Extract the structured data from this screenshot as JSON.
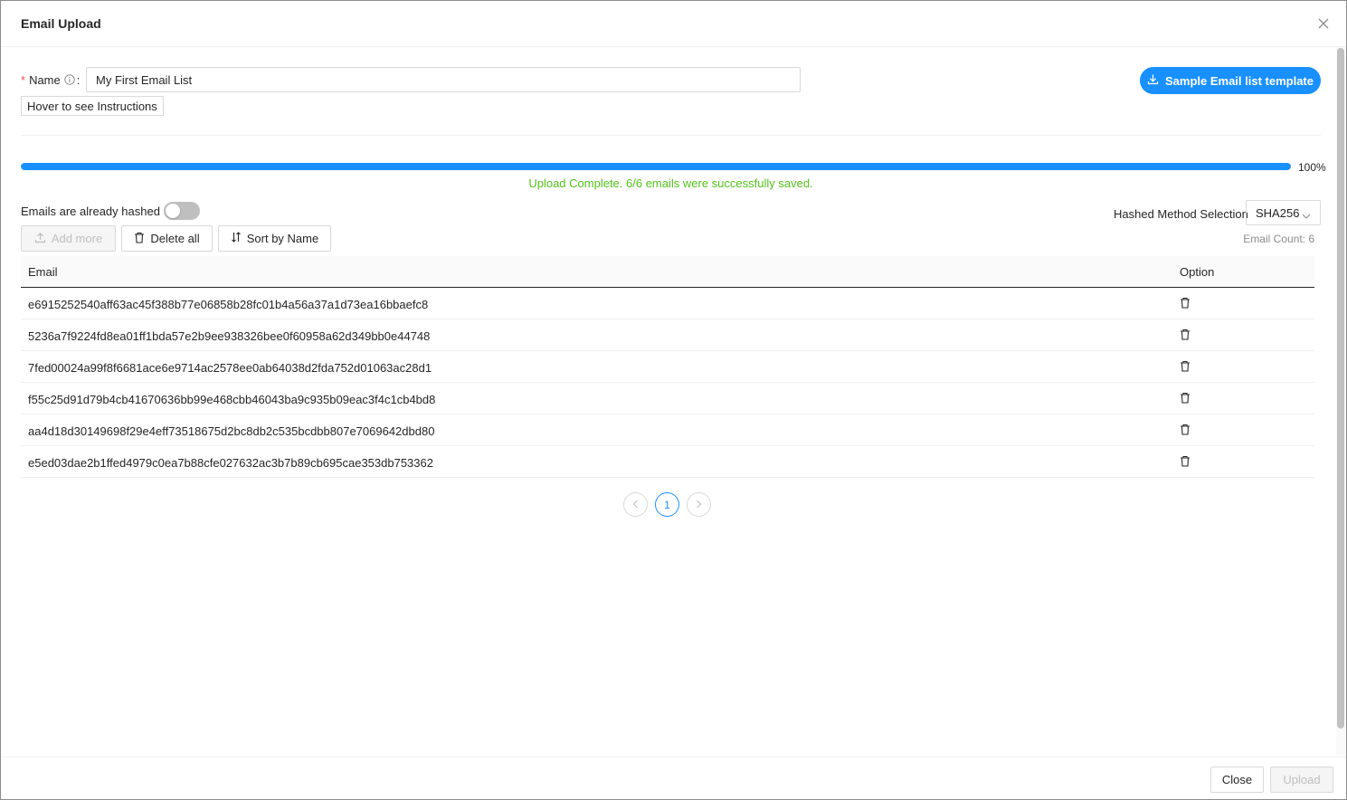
{
  "modal": {
    "title": "Email Upload"
  },
  "form": {
    "name_required_mark": "*",
    "name_label": "Name",
    "name_colon": ":",
    "name_value": "My First Email List",
    "hover_instructions_label": "Hover to see Instructions",
    "sample_template_label": "Sample Email list template"
  },
  "progress": {
    "percent": 100,
    "percent_label": "100%",
    "status_text": "Upload Complete. 6/6 emails were successfully saved.",
    "status_color": "#52c41a",
    "bar_color": "#1890ff"
  },
  "hashing": {
    "already_hashed_label": "Emails are already hashed",
    "already_hashed_on": false,
    "method_label": "Hashed Method Selection",
    "method_value": "SHA256"
  },
  "toolbar": {
    "add_more_label": "Add more",
    "delete_all_label": "Delete all",
    "sort_label": "Sort by Name",
    "email_count_label": "Email Count: 6"
  },
  "table": {
    "columns": [
      "Email",
      "Option"
    ],
    "rows": [
      "e6915252540aff63ac45f388b77e06858b28fc01b4a56a37a1d73ea16bbaefc8",
      "5236a7f9224fd8ea01ff1bda57e2b9ee938326bee0f60958a62d349bb0e44748",
      "7fed00024a99f8f6681ace6e9714ac2578ee0ab64038d2fda752d01063ac28d1",
      "f55c25d91d79b4cb41670636bb99e468cbb46043ba9c935b09eac3f4c1cb4bd8",
      "aa4d18d30149698f29e4eff73518675d2bc8db2c535bcdbb807e7069642dbd80",
      "e5ed03dae2b1ffed4979c0ea7b88cfe027632ac3b7b89cb695cae353db753362"
    ]
  },
  "pagination": {
    "current_page": "1"
  },
  "footer": {
    "close_label": "Close",
    "upload_label": "Upload"
  },
  "icons": {
    "close": "close-icon",
    "info": "info-circle-icon",
    "download": "download-icon",
    "upload": "upload-icon",
    "trash": "trash-icon",
    "sort": "sort-icon",
    "chevron": "chevron-down-icon"
  }
}
